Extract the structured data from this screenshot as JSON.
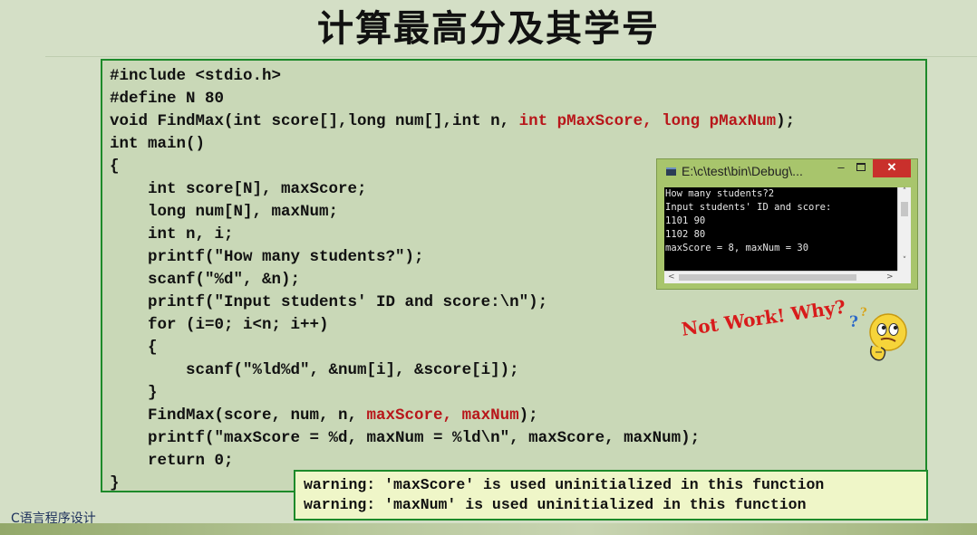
{
  "title": "计算最高分及其学号",
  "code": {
    "line1": "#include <stdio.h>",
    "line2": "#define N 80",
    "line3a": "void FindMax(int score[],long num[],int n, ",
    "line3b": "int pMaxScore, long pMaxNum",
    "line3c": ");",
    "line4": "int main()",
    "line5": "{",
    "line6": "    int score[N], maxScore;",
    "line7": "    long num[N], maxNum;",
    "line8": "    int n, i;",
    "line9": "    printf(\"How many students?\");",
    "line10": "    scanf(\"%d\", &n);",
    "line11": "    printf(\"Input students' ID and score:\\n\");",
    "line12": "    for (i=0; i<n; i++)",
    "line13": "    {",
    "line14": "        scanf(\"%ld%d\", &num[i], &score[i]);",
    "line15": "    }",
    "line16a": "    FindMax(score, num, n, ",
    "line16b": "maxScore, maxNum",
    "line16c": ");",
    "line17": "    printf(\"maxScore = %d, maxNum = %ld\\n\", maxScore, maxNum);",
    "line18": "    return 0;",
    "line19": "}"
  },
  "console": {
    "title": "E:\\c\\test\\bin\\Debug\\...",
    "minimize": "–",
    "close": "✕",
    "output": [
      "How many students?2",
      "Input students' ID and score:",
      "1101 90",
      "1102 80",
      "maxScore = 8, maxNum = 30"
    ],
    "scroll_up": "˄",
    "scroll_down": "˅",
    "scroll_left": "<",
    "scroll_right": ">"
  },
  "callout": {
    "text": "Not Work! Why?",
    "qmark_blue": "?",
    "qmark_gold": "?"
  },
  "warnings": [
    "warning: 'maxScore' is used uninitialized in this function",
    "warning: 'maxNum' is used uninitialized in this function"
  ],
  "footer": "C语言程序设计",
  "colors": {
    "highlight": "#b8161a",
    "border": "#1d8a2a",
    "callout": "#d81b1b"
  },
  "icons": {
    "console_icon": "console-window-icon",
    "thinking_face": "thinking-face-icon"
  }
}
